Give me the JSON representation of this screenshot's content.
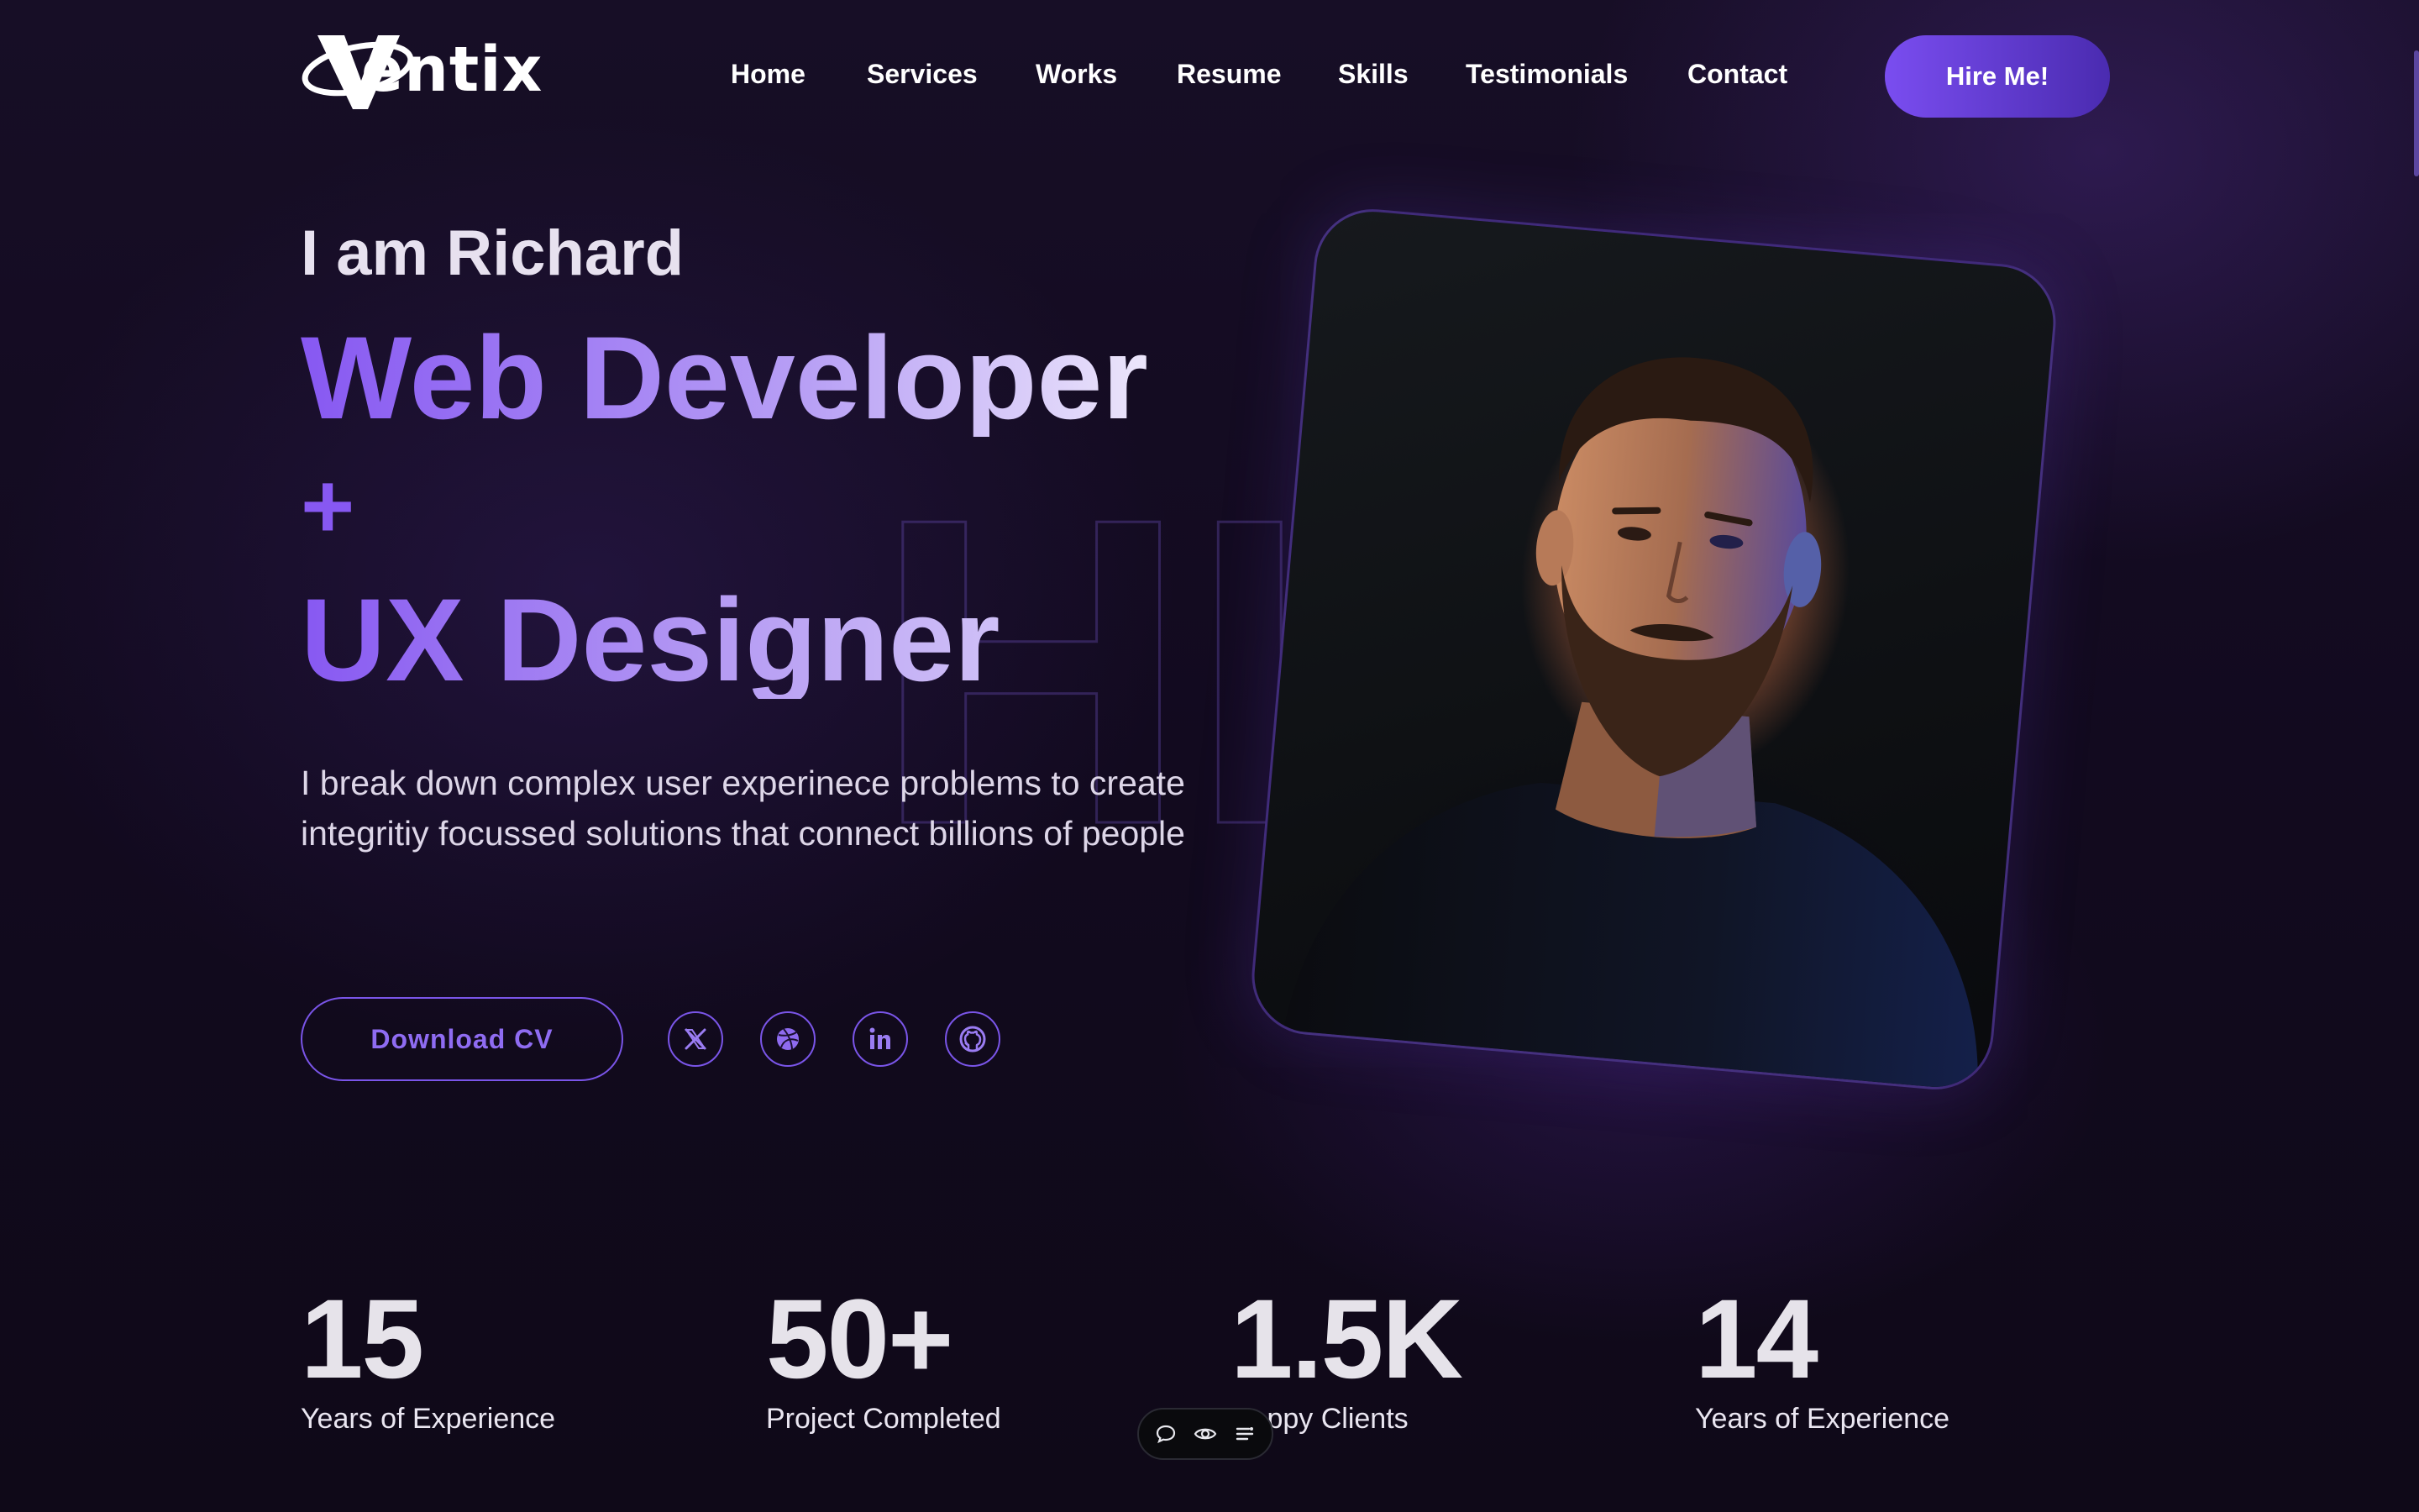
{
  "brand": {
    "logo_text": "entix"
  },
  "nav": {
    "items": [
      {
        "label": "Home"
      },
      {
        "label": "Services"
      },
      {
        "label": "Works"
      },
      {
        "label": "Resume"
      },
      {
        "label": "Skills"
      },
      {
        "label": "Testimonials"
      },
      {
        "label": "Contact"
      }
    ],
    "cta_label": "Hire Me!"
  },
  "hero": {
    "greeting": "I am Richard",
    "role_line1": "Web Developer",
    "plus": "+",
    "role_line2": "UX Designer",
    "background_word": "HI",
    "description": "I break down complex user experinece problems to create integritiy focussed solutions that connect billions of people",
    "download_label": "Download CV",
    "socials": [
      "x-icon",
      "dribbble-icon",
      "linkedin-icon",
      "github-icon"
    ]
  },
  "stats": [
    {
      "value": "15",
      "label": "Years of Experience"
    },
    {
      "value": "50+",
      "label": "Project Completed"
    },
    {
      "value": "1.5K",
      "label": "Happy Clients"
    },
    {
      "value": "14",
      "label": "Years of Experience"
    }
  ],
  "toolbar": {
    "icons": [
      "comment-icon",
      "eye-icon",
      "menu-icon"
    ]
  },
  "colors": {
    "accent": "#7a55e8",
    "accent_light": "#b8a0f5",
    "background": "#110b1c"
  }
}
